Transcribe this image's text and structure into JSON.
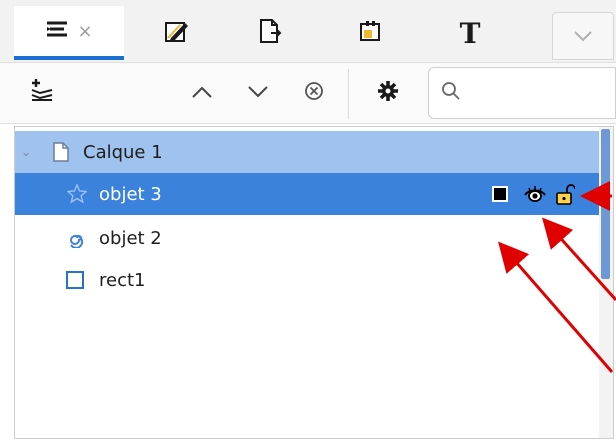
{
  "tabs": [
    {
      "name": "layers-objects",
      "close": "×",
      "active": true
    },
    {
      "name": "fill-stroke",
      "active": false
    },
    {
      "name": "document-properties",
      "active": false
    },
    {
      "name": "xml-editor",
      "active": false
    },
    {
      "name": "text-font",
      "label": "T",
      "active": false
    }
  ],
  "toolbar": {
    "search_placeholder": ""
  },
  "tree": {
    "layer": {
      "label": "Calque 1"
    },
    "items": [
      {
        "label": "objet 3",
        "selected": true
      },
      {
        "label": "objet 2",
        "selected": false
      },
      {
        "label": "rect1",
        "selected": false
      }
    ]
  },
  "colors": {
    "selection": "#3b82dc",
    "layer_row": "#9fc2ee",
    "accent": "#1b6fd1",
    "annotation_arrow": "#e00000"
  }
}
